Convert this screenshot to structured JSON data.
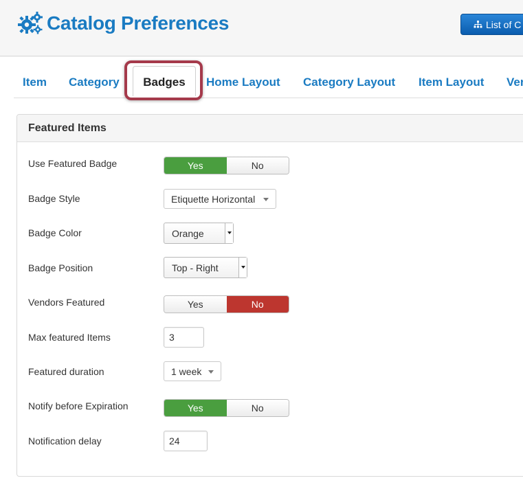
{
  "header": {
    "title": "Catalog Preferences",
    "title_icon": "gears-icon",
    "list_button_label": "List of C",
    "list_button_icon": "sitemap-icon"
  },
  "tabs": [
    {
      "label": "Item",
      "active": false
    },
    {
      "label": "Category",
      "active": false
    },
    {
      "label": "Badges",
      "active": true
    },
    {
      "label": "Home Layout",
      "active": false
    },
    {
      "label": "Category Layout",
      "active": false
    },
    {
      "label": "Item Layout",
      "active": false
    },
    {
      "label": "Ver",
      "active": false
    }
  ],
  "panel": {
    "title": "Featured Items",
    "fields": {
      "use_featured_badge": {
        "label": "Use Featured Badge",
        "yes": "Yes",
        "no": "No",
        "value": "Yes"
      },
      "badge_style": {
        "label": "Badge Style",
        "value": "Etiquette Horizontal"
      },
      "badge_color": {
        "label": "Badge Color",
        "value": "Orange"
      },
      "badge_position": {
        "label": "Badge Position",
        "value": "Top - Right"
      },
      "vendors_featured": {
        "label": "Vendors Featured",
        "yes": "Yes",
        "no": "No",
        "value": "No"
      },
      "max_featured_items": {
        "label": "Max featured Items",
        "value": "3"
      },
      "featured_duration": {
        "label": "Featured duration",
        "value": "1 week"
      },
      "notify_before_expiration": {
        "label": "Notify before Expiration",
        "yes": "Yes",
        "no": "No",
        "value": "Yes"
      },
      "notification_delay": {
        "label": "Notification delay",
        "value": "24"
      }
    }
  },
  "colors": {
    "brand_blue": "#1a7bc2",
    "toggle_yes_on": "#4a9e3f",
    "toggle_no_on": "#bd362f",
    "highlight_outline": "#a53a4b"
  }
}
